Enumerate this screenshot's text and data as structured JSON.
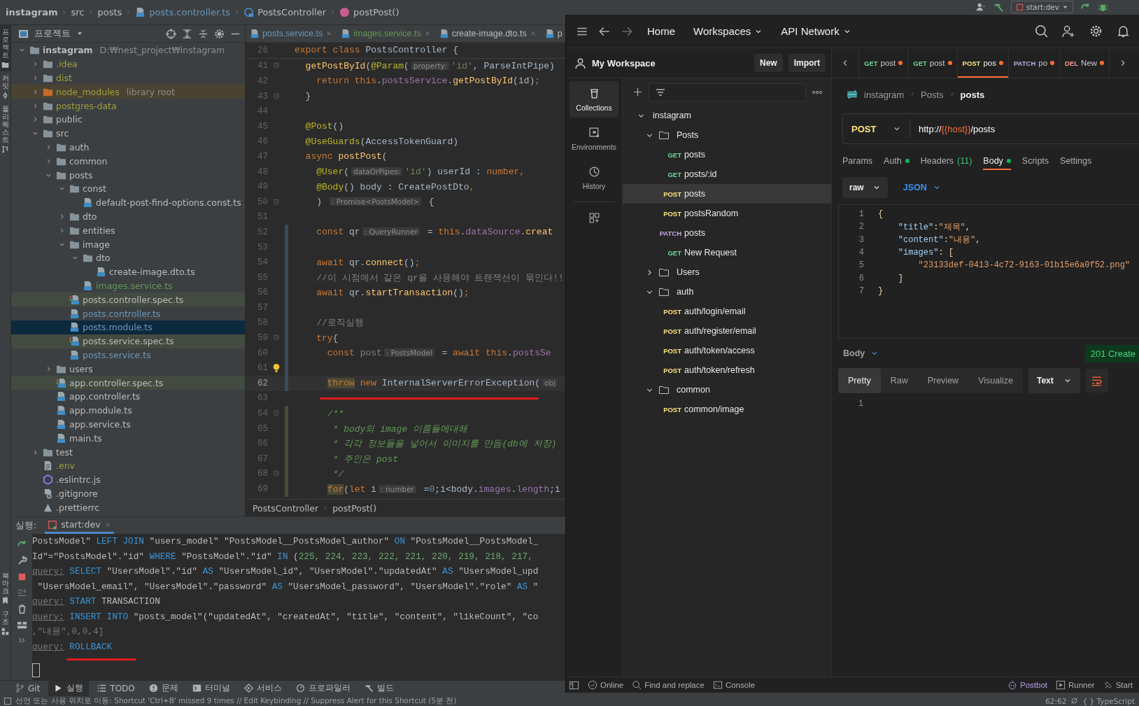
{
  "ide": {
    "breadcrumb": [
      {
        "label": "instagram",
        "kind": "project"
      },
      {
        "label": "src",
        "kind": "dir"
      },
      {
        "label": "posts",
        "kind": "dir"
      },
      {
        "label": "posts.controller.ts",
        "kind": "ts"
      },
      {
        "label": "PostsController",
        "kind": "class"
      },
      {
        "label": "postPost()",
        "kind": "method"
      }
    ],
    "run_config": "start:dev",
    "side_stripe": {
      "top": [
        {
          "label": "프로젝트",
          "selected": true
        },
        {
          "label": "커밋",
          "selected": false
        },
        {
          "label": "풀 리퀘스트",
          "selected": false
        }
      ],
      "bottom": [
        {
          "label": "북마크",
          "selected": false
        },
        {
          "label": "구조",
          "selected": false
        }
      ]
    },
    "project_panel": {
      "title": "프로젝트",
      "tree": [
        {
          "name": "instagram",
          "kind": "project",
          "note": "D:₩nest_project₩instagram",
          "expanded": true,
          "selected": false,
          "children": [
            {
              "name": ".idea",
              "kind": "folder",
              "color": "#9e9e3b",
              "expanded": false,
              "selected": false
            },
            {
              "name": "dist",
              "kind": "folder",
              "color": "#9e9e3b",
              "expanded": false,
              "selected": false
            },
            {
              "name": "node_modules",
              "kind": "folder",
              "color": "#9e9e3b",
              "library": true,
              "note": "library root",
              "expanded": false,
              "selected": false
            },
            {
              "name": "postgres-data",
              "kind": "folder",
              "color": "#9e9e3b",
              "expanded": false,
              "selected": false
            },
            {
              "name": "public",
              "kind": "folder",
              "expanded": false,
              "selected": false
            },
            {
              "name": "src",
              "kind": "folder",
              "expanded": true,
              "selected": false,
              "children": [
                {
                  "name": "auth",
                  "kind": "folder",
                  "expanded": false,
                  "selected": false
                },
                {
                  "name": "common",
                  "kind": "folder",
                  "expanded": false,
                  "selected": false
                },
                {
                  "name": "posts",
                  "kind": "folder",
                  "expanded": true,
                  "selected": false,
                  "children": [
                    {
                      "name": "const",
                      "kind": "folder",
                      "expanded": true,
                      "selected": false,
                      "children": [
                        {
                          "name": "default-post-find-options.const.ts",
                          "kind": "ts",
                          "selected": false
                        }
                      ]
                    },
                    {
                      "name": "dto",
                      "kind": "folder",
                      "expanded": false,
                      "selected": false
                    },
                    {
                      "name": "entities",
                      "kind": "folder",
                      "expanded": false,
                      "selected": false
                    },
                    {
                      "name": "image",
                      "kind": "folder",
                      "expanded": true,
                      "selected": false,
                      "children": [
                        {
                          "name": "dto",
                          "kind": "folder",
                          "expanded": true,
                          "selected": false,
                          "children": [
                            {
                              "name": "create-image.dto.ts",
                              "kind": "ts",
                              "selected": false
                            }
                          ]
                        },
                        {
                          "name": "images.service.ts",
                          "kind": "ts",
                          "color": "#629755",
                          "selected": false
                        }
                      ]
                    },
                    {
                      "name": "posts.controller.spec.ts",
                      "kind": "spec",
                      "test": true,
                      "selected": false
                    },
                    {
                      "name": "posts.controller.ts",
                      "kind": "ts",
                      "color": "#6897bb",
                      "selected": false
                    },
                    {
                      "name": "posts.module.ts",
                      "kind": "ts",
                      "color": "#6897bb",
                      "selected": true
                    },
                    {
                      "name": "posts.service.spec.ts",
                      "kind": "spec",
                      "test": true,
                      "selected": false
                    },
                    {
                      "name": "posts.service.ts",
                      "kind": "ts",
                      "color": "#6897bb",
                      "selected": false
                    }
                  ]
                },
                {
                  "name": "users",
                  "kind": "folder",
                  "expanded": false,
                  "selected": false
                },
                {
                  "name": "app.controller.spec.ts",
                  "kind": "spec",
                  "test": true,
                  "selected": false
                },
                {
                  "name": "app.controller.ts",
                  "kind": "ts",
                  "selected": false
                },
                {
                  "name": "app.module.ts",
                  "kind": "ts",
                  "selected": false
                },
                {
                  "name": "app.service.ts",
                  "kind": "ts",
                  "selected": false
                },
                {
                  "name": "main.ts",
                  "kind": "ts",
                  "selected": false
                }
              ]
            },
            {
              "name": "test",
              "kind": "folder",
              "expanded": false,
              "selected": false
            },
            {
              "name": ".env",
              "kind": "env",
              "color": "#9e9e3b",
              "selected": false
            },
            {
              "name": ".eslintrc.js",
              "kind": "eslint",
              "selected": false
            },
            {
              "name": ".gitignore",
              "kind": "gitignore",
              "selected": false
            },
            {
              "name": ".prettierrc",
              "kind": "config",
              "selected": false
            }
          ]
        }
      ]
    },
    "editor": {
      "tabs": [
        {
          "label": "posts.service.ts",
          "color": "#6897bb",
          "selected": false
        },
        {
          "label": "images.service.ts",
          "color": "#629755",
          "selected": false
        },
        {
          "label": "create-image.dto.ts",
          "selected": false
        },
        {
          "label": "p",
          "selected": false
        }
      ],
      "lines": [
        {
          "num": "26",
          "current": false,
          "underlined": false,
          "sticky": true,
          "tokens": [
            {
              "text": "export class ",
              "kind": "kw"
            },
            {
              "text": "PostsController {",
              "kind": "plain"
            }
          ]
        },
        {
          "num": "41",
          "current": false,
          "underlined": false,
          "fold": true,
          "tokens": [
            {
              "text": "  getPostById",
              "kind": "fn"
            },
            {
              "text": "(",
              "kind": "plain"
            },
            {
              "text": "@Param",
              "kind": "dec"
            },
            {
              "text": "(",
              "kind": "plain"
            },
            {
              "text": "property:",
              "kind": "hint"
            },
            {
              "text": "'id'",
              "kind": "str"
            },
            {
              "text": ", ParseIntPipe)",
              "kind": "plain"
            }
          ]
        },
        {
          "num": "42",
          "current": false,
          "underlined": false,
          "tokens": [
            {
              "text": "    return this",
              "kind": "kw"
            },
            {
              "text": ".",
              "kind": "plain"
            },
            {
              "text": "postsService",
              "kind": "field"
            },
            {
              "text": ".",
              "kind": "plain"
            },
            {
              "text": "getPostById",
              "kind": "fn"
            },
            {
              "text": "(id)",
              "kind": "plain"
            },
            {
              "text": ";",
              "kind": "kw"
            }
          ]
        },
        {
          "num": "43",
          "current": false,
          "underlined": false,
          "fold": true,
          "tokens": [
            {
              "text": "  }",
              "kind": "plain"
            }
          ]
        },
        {
          "num": "44",
          "current": false,
          "underlined": false
        },
        {
          "num": "45",
          "current": false,
          "underlined": false,
          "tokens": [
            {
              "text": "  @Post",
              "kind": "dec"
            },
            {
              "text": "()",
              "kind": "plain"
            }
          ]
        },
        {
          "num": "46",
          "current": false,
          "underlined": false,
          "tokens": [
            {
              "text": "  @UseGuards",
              "kind": "dec"
            },
            {
              "text": "(AccessTokenGuard)",
              "kind": "plain"
            }
          ]
        },
        {
          "num": "47",
          "current": false,
          "underlined": false,
          "tokens": [
            {
              "text": "  async ",
              "kind": "kw"
            },
            {
              "text": "postPost",
              "kind": "fn"
            },
            {
              "text": "(",
              "kind": "plain"
            }
          ]
        },
        {
          "num": "48",
          "current": false,
          "underlined": false,
          "tokens": [
            {
              "text": "    @User",
              "kind": "dec"
            },
            {
              "text": "(",
              "kind": "plain"
            },
            {
              "text": "dataOrPipes:",
              "kind": "hint"
            },
            {
              "text": "'id'",
              "kind": "str"
            },
            {
              "text": ") userId : ",
              "kind": "plain"
            },
            {
              "text": "number,",
              "kind": "kw"
            }
          ]
        },
        {
          "num": "49",
          "current": false,
          "underlined": false,
          "tokens": [
            {
              "text": "    @Body",
              "kind": "dec"
            },
            {
              "text": "() body : CreatePostDto",
              "kind": "plain"
            },
            {
              "text": ",",
              "kind": "kw"
            }
          ]
        },
        {
          "num": "50",
          "current": false,
          "underlined": false,
          "fold": true,
          "tokens": [
            {
              "text": "    ) ",
              "kind": "plain"
            },
            {
              "text": ": Promise<PostsModel>",
              "kind": "hint"
            },
            {
              "text": " {",
              "kind": "plain"
            }
          ]
        },
        {
          "num": "51",
          "current": false,
          "underlined": false
        },
        {
          "num": "52",
          "current": false,
          "underlined": false,
          "modified": true,
          "tokens": [
            {
              "text": "    const ",
              "kind": "kw"
            },
            {
              "text": "qr",
              "kind": "plain"
            },
            {
              "text": ": QueryRunner",
              "kind": "hint"
            },
            {
              "text": " = ",
              "kind": "plain"
            },
            {
              "text": "this",
              "kind": "kw"
            },
            {
              "text": ".",
              "kind": "plain"
            },
            {
              "text": "dataSource",
              "kind": "field"
            },
            {
              "text": ".",
              "kind": "plain"
            },
            {
              "text": "creat",
              "kind": "fn"
            }
          ]
        },
        {
          "num": "53",
          "current": false,
          "underlined": false,
          "modified": true
        },
        {
          "num": "54",
          "current": false,
          "underlined": false,
          "modified": true,
          "tokens": [
            {
              "text": "    await ",
              "kind": "kw"
            },
            {
              "text": "qr.",
              "kind": "plain"
            },
            {
              "text": "connect",
              "kind": "fn"
            },
            {
              "text": "()",
              "kind": "plain"
            },
            {
              "text": ";",
              "kind": "kw"
            }
          ]
        },
        {
          "num": "55",
          "current": false,
          "underlined": false,
          "modified": true,
          "tokens": [
            {
              "text": "    //이 시점에서 같은 qr을 사용해야 트랜잭션이 묶인다!!",
              "kind": "cmt"
            }
          ]
        },
        {
          "num": "56",
          "current": false,
          "underlined": false,
          "modified": true,
          "tokens": [
            {
              "text": "    await ",
              "kind": "kw"
            },
            {
              "text": "qr.",
              "kind": "plain"
            },
            {
              "text": "startTransaction",
              "kind": "fn"
            },
            {
              "text": "()",
              "kind": "plain"
            },
            {
              "text": ";",
              "kind": "kw"
            }
          ]
        },
        {
          "num": "57",
          "current": false,
          "underlined": false,
          "modified": true
        },
        {
          "num": "58",
          "current": false,
          "underlined": false,
          "modified": true,
          "tokens": [
            {
              "text": "    //로직실행",
              "kind": "cmt"
            }
          ]
        },
        {
          "num": "59",
          "current": false,
          "underlined": false,
          "modified": true,
          "fold": true,
          "tokens": [
            {
              "text": "    try",
              "kind": "kw"
            },
            {
              "text": "{",
              "kind": "plain"
            }
          ]
        },
        {
          "num": "60",
          "current": false,
          "underlined": false,
          "modified": true,
          "tokens": [
            {
              "text": "      const ",
              "kind": "kw"
            },
            {
              "text": "post",
              "kind": "unused"
            },
            {
              "text": ": PostsModel",
              "kind": "hint"
            },
            {
              "text": " = ",
              "kind": "plain"
            },
            {
              "text": "await this",
              "kind": "kw"
            },
            {
              "text": ".",
              "kind": "plain"
            },
            {
              "text": "postsSe",
              "kind": "field"
            }
          ]
        },
        {
          "num": "61",
          "current": false,
          "underlined": false,
          "modified": true,
          "bulb": true
        },
        {
          "num": "62",
          "current": true,
          "underlined": false,
          "modified": true,
          "tokens": [
            {
              "text": "      throw",
              "kind": "kw_marked"
            },
            {
              "text": " new ",
              "kind": "kw"
            },
            {
              "text": "InternalServerErrorException(",
              "kind": "plain"
            },
            {
              "text": "obj",
              "kind": "hint"
            }
          ]
        },
        {
          "num": "63",
          "current": false,
          "underlined": true
        },
        {
          "num": "64",
          "current": false,
          "underlined": false,
          "added": true,
          "fold": true,
          "tokens": [
            {
              "text": "      /**",
              "kind": "doc"
            }
          ]
        },
        {
          "num": "65",
          "current": false,
          "underlined": false,
          "added": true,
          "tokens": [
            {
              "text": "       * body의 image 이름들에대해",
              "kind": "doc"
            }
          ]
        },
        {
          "num": "66",
          "current": false,
          "underlined": false,
          "added": true,
          "tokens": [
            {
              "text": "       * 각각 정보들을 넣어서 이미지를 만듬(db에 저장)",
              "kind": "doc"
            }
          ]
        },
        {
          "num": "67",
          "current": false,
          "underlined": false,
          "added": true,
          "tokens": [
            {
              "text": "       * 주인은 post",
              "kind": "doc"
            }
          ]
        },
        {
          "num": "68",
          "current": false,
          "underlined": false,
          "added": true,
          "fold": true,
          "tokens": [
            {
              "text": "       */",
              "kind": "doc"
            }
          ]
        },
        {
          "num": "69",
          "current": false,
          "underlined": false,
          "added": true,
          "tokens": [
            {
              "text": "      for",
              "kind": "kw_marked"
            },
            {
              "text": "(",
              "kind": "plain"
            },
            {
              "text": "let ",
              "kind": "kw"
            },
            {
              "text": "i",
              "kind": "plain"
            },
            {
              "text": ": number",
              "kind": "hint"
            },
            {
              "text": " =",
              "kind": "plain"
            },
            {
              "text": "0",
              "kind": "num"
            },
            {
              "text": ";i<body.",
              "kind": "plain"
            },
            {
              "text": "images",
              "kind": "field"
            },
            {
              "text": ".",
              "kind": "plain"
            },
            {
              "text": "length",
              "kind": "field"
            },
            {
              "text": ";i",
              "kind": "plain"
            }
          ]
        }
      ],
      "breadcrumb": [
        "PostsController",
        "postPost()"
      ]
    },
    "run_panel": {
      "label": "실행:",
      "tab": "start:dev",
      "lines": [
        {
          "underlined": false,
          "tokens": [
            {
              "text": "PostsModel\" ",
              "kind": "plain"
            },
            {
              "text": "LEFT JOIN",
              "kind": "kw"
            },
            {
              "text": " \"users_model\" \"PostsModel__PostsModel_author\" ",
              "kind": "plain"
            },
            {
              "text": "ON",
              "kind": "kw"
            },
            {
              "text": " \"PostsModel__PostsModel_",
              "kind": "plain"
            }
          ]
        },
        {
          "underlined": false,
          "tokens": [
            {
              "text": "Id\"=\"PostsModel\".\"id\" ",
              "kind": "plain"
            },
            {
              "text": "WHERE",
              "kind": "kw"
            },
            {
              "text": " \"PostsModel\".\"id\" ",
              "kind": "plain"
            },
            {
              "text": "IN",
              "kind": "kw"
            },
            {
              "text": " (",
              "kind": "plain"
            },
            {
              "text": "225, 224, 223, 222, 221, 220, 219, 218, 217,",
              "kind": "num"
            }
          ]
        },
        {
          "underlined": false,
          "tokens": [
            {
              "text": "query:",
              "kind": "label"
            },
            {
              "text": " SELECT",
              "kind": "kw"
            },
            {
              "text": " \"UsersModel\".\"id\" ",
              "kind": "plain"
            },
            {
              "text": "AS",
              "kind": "kw"
            },
            {
              "text": " \"UsersModel_id\", \"UsersModel\".\"updatedAt\" ",
              "kind": "plain"
            },
            {
              "text": "AS",
              "kind": "kw"
            },
            {
              "text": " \"UsersModel_upd",
              "kind": "plain"
            }
          ]
        },
        {
          "underlined": false,
          "tokens": [
            {
              "text": " \"UsersModel_email\", \"UsersModel\".\"password\" ",
              "kind": "plain"
            },
            {
              "text": "AS",
              "kind": "kw"
            },
            {
              "text": " \"UsersModel_password\", \"UsersModel\".\"role\" ",
              "kind": "plain"
            },
            {
              "text": "AS",
              "kind": "kw"
            },
            {
              "text": " \"",
              "kind": "plain"
            }
          ]
        },
        {
          "underlined": false,
          "tokens": [
            {
              "text": "query:",
              "kind": "label"
            },
            {
              "text": " START",
              "kind": "kw"
            },
            {
              "text": " TRANSACTION",
              "kind": "plain"
            }
          ]
        },
        {
          "underlined": false,
          "tokens": [
            {
              "text": "query:",
              "kind": "label"
            },
            {
              "text": " INSERT INTO",
              "kind": "kw"
            },
            {
              "text": " \"posts_model\"(\"updatedAt\", \"createdAt\", \"title\", \"content\", \"likeCount\", \"co",
              "kind": "plain"
            }
          ]
        },
        {
          "underlined": false,
          "tokens": [
            {
              "text": ",\"내용\",0,0,4]",
              "kind": "dim"
            }
          ]
        },
        {
          "underlined": true,
          "tokens": [
            {
              "text": "query:",
              "kind": "label"
            },
            {
              "text": " ROLLBACK",
              "kind": "kw"
            }
          ]
        }
      ]
    },
    "tool_windows": [
      {
        "label": "Git",
        "selected": false
      },
      {
        "label": "실행",
        "selected": true
      },
      {
        "label": "TODO",
        "selected": false
      },
      {
        "label": "문제",
        "selected": false
      },
      {
        "label": "터미널",
        "selected": false
      },
      {
        "label": "서비스",
        "selected": false
      },
      {
        "label": "프로파일러",
        "selected": false
      },
      {
        "label": "빌드",
        "selected": false
      }
    ],
    "status": {
      "message": "선언 또는 사용 위치로 이동: Shortcut 'Ctrl+B' missed 9 times // Edit Keybinding // Suppress Alert for this Shortcut (5분 전)",
      "position": "62:62",
      "language": "{ } TypeScript"
    }
  },
  "postman": {
    "nav": [
      {
        "label": "Home",
        "dropdown": false
      },
      {
        "label": "Workspaces",
        "dropdown": true
      },
      {
        "label": "API Network",
        "dropdown": true
      }
    ],
    "workspace": {
      "name": "My Workspace",
      "buttons": [
        "New",
        "Import"
      ]
    },
    "rail": [
      {
        "label": "Collections",
        "selected": true
      },
      {
        "label": "Environments",
        "selected": false
      },
      {
        "label": "History",
        "selected": false
      }
    ],
    "collection": [
      {
        "name": "instagram",
        "kind": "collection",
        "expanded": true,
        "children": [
          {
            "name": "Posts",
            "kind": "folder",
            "expanded": true,
            "children": [
              {
                "kind": "request",
                "method": "GET",
                "color": "#6bdd9a",
                "name": "posts",
                "selected": false
              },
              {
                "kind": "request",
                "method": "GET",
                "color": "#6bdd9a",
                "name": "posts/:id",
                "selected": false
              },
              {
                "kind": "request",
                "method": "POST",
                "color": "#ffe47e",
                "name": "posts",
                "selected": true
              },
              {
                "kind": "request",
                "method": "POST",
                "color": "#ffe47e",
                "name": "postsRandom",
                "selected": false
              },
              {
                "kind": "request",
                "method": "PATCH",
                "color": "#c0a8e1",
                "name": "posts",
                "selected": false
              },
              {
                "kind": "request",
                "method": "GET",
                "color": "#6bdd9a",
                "name": "New Request",
                "selected": false
              }
            ]
          },
          {
            "name": "Users",
            "kind": "folder",
            "expanded": false
          },
          {
            "name": "auth",
            "kind": "folder",
            "expanded": true,
            "children": [
              {
                "kind": "request",
                "method": "POST",
                "color": "#ffe47e",
                "name": "auth/login/email",
                "selected": false
              },
              {
                "kind": "request",
                "method": "POST",
                "color": "#ffe47e",
                "name": "auth/register/email",
                "selected": false
              },
              {
                "kind": "request",
                "method": "POST",
                "color": "#ffe47e",
                "name": "auth/token/access",
                "selected": false
              },
              {
                "kind": "request",
                "method": "POST",
                "color": "#ffe47e",
                "name": "auth/token/refresh",
                "selected": false
              }
            ]
          },
          {
            "name": "common",
            "kind": "folder",
            "expanded": true,
            "children": [
              {
                "kind": "request",
                "method": "POST",
                "color": "#ffe47e",
                "name": "common/image",
                "selected": false
              }
            ]
          }
        ]
      }
    ],
    "tabs": [
      {
        "method": "GET",
        "color": "#6bdd9a",
        "label": "post",
        "unsaved": true,
        "selected": false
      },
      {
        "method": "GET",
        "color": "#6bdd9a",
        "label": "post",
        "unsaved": true,
        "selected": false
      },
      {
        "method": "POST",
        "color": "#ffe47e",
        "label": "pos",
        "unsaved": true,
        "selected": true
      },
      {
        "method": "PATCH",
        "color": "#c0a8e1",
        "label": "po",
        "unsaved": true,
        "selected": false
      },
      {
        "method": "DEL",
        "color": "#f79a8e",
        "label": "New",
        "unsaved": true,
        "selected": false
      }
    ],
    "breadcrumb": [
      "instagram",
      "Posts",
      "posts"
    ],
    "request": {
      "method": "POST",
      "url": [
        {
          "text": "http://",
          "kind": "plain"
        },
        {
          "text": "{{host}}",
          "kind": "variable"
        },
        {
          "text": "/posts",
          "kind": "plain"
        }
      ]
    },
    "request_tabs": [
      {
        "label": "Params",
        "dot": false,
        "selected": false
      },
      {
        "label": "Auth",
        "dot": true,
        "selected": false
      },
      {
        "label": "Headers",
        "count": "(11)",
        "dot": false,
        "selected": false
      },
      {
        "label": "Body",
        "dot": true,
        "selected": true
      },
      {
        "label": "Scripts",
        "dot": false,
        "selected": false
      },
      {
        "label": "Settings",
        "dot": false,
        "selected": false
      }
    ],
    "body_mode": "raw",
    "body_language": "JSON",
    "body_lines": [
      {
        "num": "1",
        "tokens": [
          {
            "text": "{",
            "kind": "punct"
          }
        ]
      },
      {
        "num": "2",
        "tokens": [
          {
            "text": "    \"title\"",
            "kind": "key"
          },
          {
            "text": ":",
            "kind": "punct"
          },
          {
            "text": "\"제목\"",
            "kind": "str"
          },
          {
            "text": ",",
            "kind": "punct"
          }
        ]
      },
      {
        "num": "3",
        "tokens": [
          {
            "text": "    \"content\"",
            "kind": "key"
          },
          {
            "text": ":",
            "kind": "punct"
          },
          {
            "text": "\"내용\"",
            "kind": "str"
          },
          {
            "text": ",",
            "kind": "punct"
          }
        ]
      },
      {
        "num": "4",
        "tokens": [
          {
            "text": "    \"images\"",
            "kind": "key"
          },
          {
            "text": ": [",
            "kind": "punct"
          }
        ]
      },
      {
        "num": "5",
        "tokens": [
          {
            "text": "        \"23133def-0413-4c72-9163-01b15e6a0f52.png\"",
            "kind": "str"
          }
        ]
      },
      {
        "num": "6",
        "tokens": [
          {
            "text": "    ]",
            "kind": "punct"
          }
        ]
      },
      {
        "num": "7",
        "tokens": [
          {
            "text": "}",
            "kind": "punct"
          }
        ]
      }
    ],
    "response": {
      "label": "Body",
      "status": "201 Create",
      "views": [
        {
          "label": "Pretty",
          "selected": true
        },
        {
          "label": "Raw",
          "selected": false
        },
        {
          "label": "Preview",
          "selected": false
        },
        {
          "label": "Visualize",
          "selected": false
        }
      ],
      "format": "Text",
      "lines": [
        "1"
      ]
    },
    "status_bar": {
      "left": [
        "Online",
        "Find and replace",
        "Console"
      ],
      "right": [
        "Postbot",
        "Runner",
        "Start"
      ]
    }
  }
}
